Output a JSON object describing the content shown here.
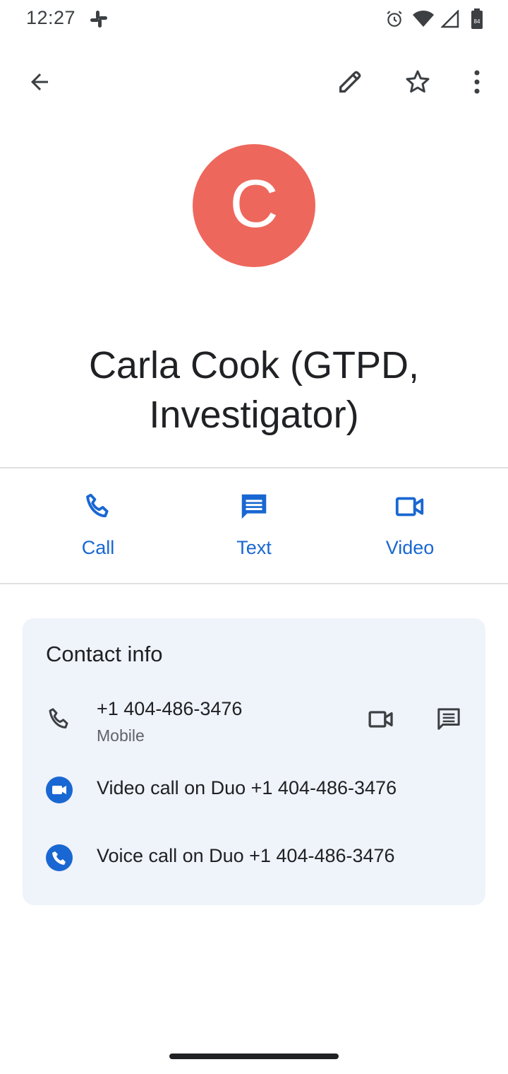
{
  "status_bar": {
    "time": "12:27",
    "icons": [
      "slack-icon",
      "alarm-icon",
      "wifi-icon",
      "signal-icon",
      "battery-icon"
    ],
    "battery_level": "84"
  },
  "toolbar": {
    "back_icon": "arrow-back-icon",
    "edit_icon": "pencil-icon",
    "favorite_icon": "star-outline-icon",
    "more_icon": "more-vert-icon"
  },
  "contact": {
    "avatar_letter": "C",
    "avatar_color": "#ee675c",
    "name": "Carla Cook (GTPD, Investigator)"
  },
  "actions": {
    "call_label": "Call",
    "text_label": "Text",
    "video_label": "Video",
    "accent": "#1967d2"
  },
  "contact_info": {
    "title": "Contact info",
    "phone": {
      "number": "+1 404-486-3476",
      "type": "Mobile"
    },
    "duo_video": "Video call on Duo +1 404-486-3476",
    "duo_voice": "Voice call on Duo +1 404-486-3476"
  }
}
